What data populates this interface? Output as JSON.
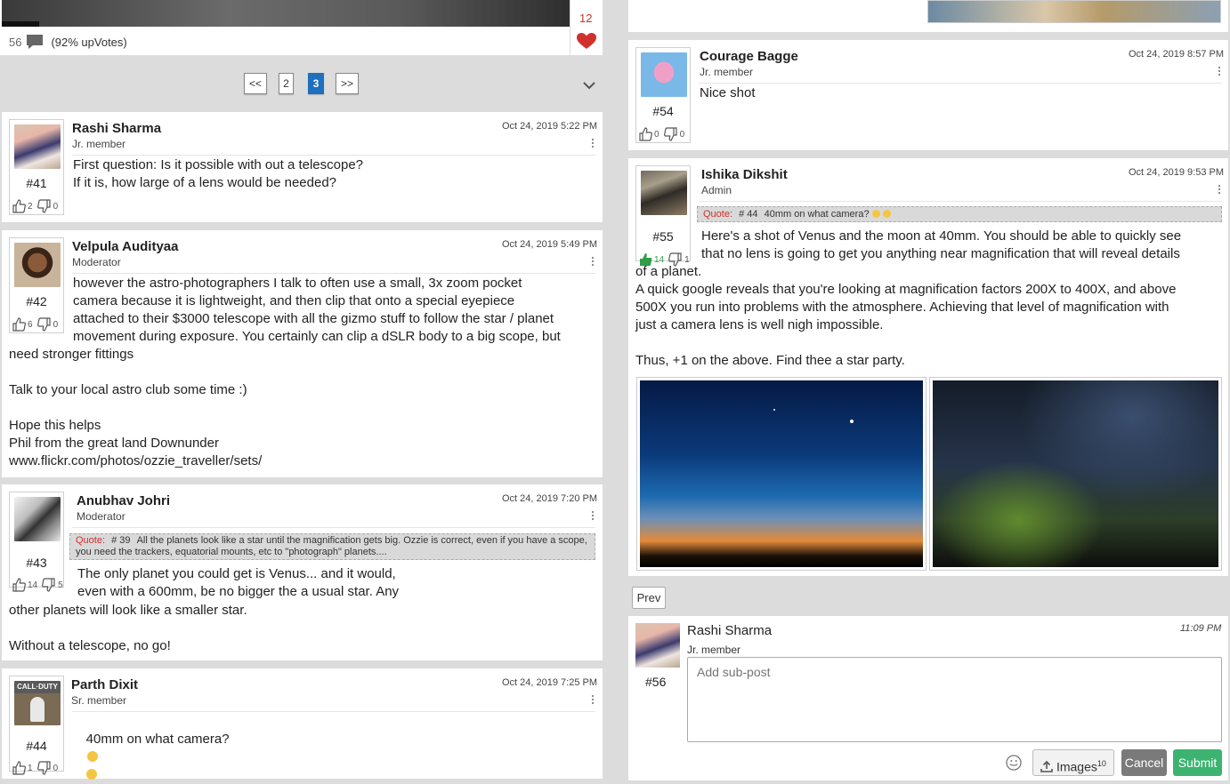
{
  "top_post": {
    "comment_count": "56",
    "upvotes": "(92% upVotes)",
    "likes": "12"
  },
  "pager": {
    "prev": "<<",
    "pages": [
      "2",
      "3"
    ],
    "current": "3",
    "next": ">>"
  },
  "posts_left": [
    {
      "name": "Rashi Sharma",
      "role": "Jr. member",
      "date": "Oct 24, 2019 5:22 PM",
      "num": "#41",
      "up": "2",
      "down": "0",
      "body": "First question: Is it possible with out a telescope?\nIf it is, how large of a lens would be needed?"
    },
    {
      "name": "Velpula Audityaa",
      "role": "Moderator",
      "date": "Oct 24, 2019 5:49 PM",
      "num": "#42",
      "up": "6",
      "down": "0",
      "body_lines": [
        "however the astro-photographers I talk to often use a small, 3x zoom pocket",
        "camera because it is lightweight, and then clip that onto a special eyepiece",
        "attached to their $3000 telescope with all the gizmo stuff to follow the star / planet",
        "movement during exposure. You certainly can clip a dSLR body to a big scope, but"
      ],
      "body_rest": "need stronger fittings\n\nTalk to your local astro club some time :)\n\nHope this helps\nPhil from the great land Downunder\nwww.flickr.com/photos/ozzie_traveller/sets/"
    },
    {
      "name": "Anubhav Johri",
      "role": "Moderator",
      "date": "Oct 24, 2019 7:20 PM",
      "num": "#43",
      "up": "14",
      "down": "5",
      "quote_label": "Quote:",
      "quote_ref": "# 39",
      "quote_text": "All the planets look like a star until the magnification gets big. Ozzie is correct, even if you have a scope, you need the trackers, equatorial mounts, etc to \"photograph\" planets....",
      "body_lines": [
        "The only planet you could get is Venus... and it would,",
        "even with a 600mm, be no bigger the a usual star. Any"
      ],
      "body_rest": "other planets will look like a smaller star.\n\nWithout a telescope, no go!"
    },
    {
      "name": "Parth Dixit",
      "role": "Sr. member",
      "date": "Oct 24, 2019 7:25 PM",
      "num": "#44",
      "up": "1",
      "down": "0",
      "body": "40mm on what camera?",
      "avatar_text": "CALL·DUTY"
    }
  ],
  "posts_right": [
    {
      "name": "Courage Bagge",
      "role": "Jr. member",
      "date": "Oct 24, 2019 8:57 PM",
      "num": "#54",
      "up": "0",
      "down": "0",
      "body": "Nice shot"
    },
    {
      "name": "Ishika Dikshit",
      "role": "Admin",
      "date": "Oct 24, 2019 9:53 PM",
      "num": "#55",
      "up": "14",
      "down": "1",
      "quote_label": "Quote:",
      "quote_ref": "# 44",
      "quote_text": "40mm on what camera?",
      "body_lines": [
        "Here's a shot of Venus and the moon at 40mm. You should be able to quickly see",
        "that no lens is going to get you anything near magnification that will reveal details"
      ],
      "body_rest": "of a planet.\nA quick google reveals that you're looking at magnification factors 200X to 400X, and above\n500X you run into problems with the atmosphere. Achieving that level of magnification with\njust a camera lens is well nigh impossible.\n\nThus, +1 on the above. Find thee a star party."
    }
  ],
  "prev_button": "Prev",
  "reply": {
    "name": "Rashi Sharma",
    "role": "Jr. member",
    "time": "11:09 PM",
    "num": "#56",
    "placeholder": "Add sub-post",
    "images_label": "Images",
    "images_count": "10",
    "cancel": "Cancel",
    "submit": "Submit"
  },
  "colors": {
    "accent": "#1f6fbf",
    "heart": "#d0312d",
    "submit": "#3cb371",
    "cancel": "#7a7a7a"
  }
}
